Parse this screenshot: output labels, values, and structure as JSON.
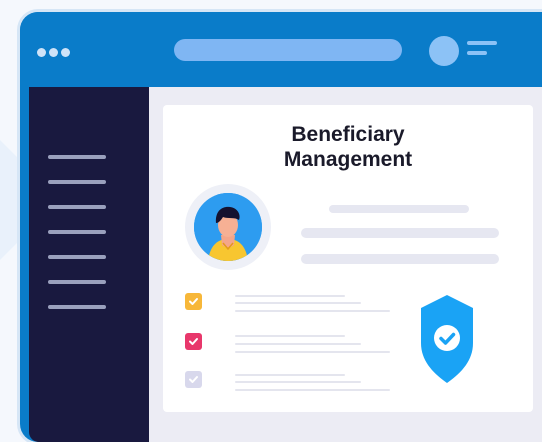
{
  "title_line1": "Beneficiary",
  "title_line2": "Management",
  "colors": {
    "topbar": "#0a7cc9",
    "sidebar": "#19193f",
    "shield": "#1aa3f5",
    "check_orange": "#f7b739",
    "check_red": "#e8376b",
    "check_lavender": "#d8d8ec"
  },
  "icons": [
    "window-dots-icon",
    "avatar-icon",
    "hamburger-icon",
    "checkbox-icon",
    "shield-check-icon"
  ],
  "checklist": [
    {
      "state": "checked",
      "color": "orange"
    },
    {
      "state": "checked",
      "color": "red"
    },
    {
      "state": "checked",
      "color": "lavender"
    }
  ]
}
